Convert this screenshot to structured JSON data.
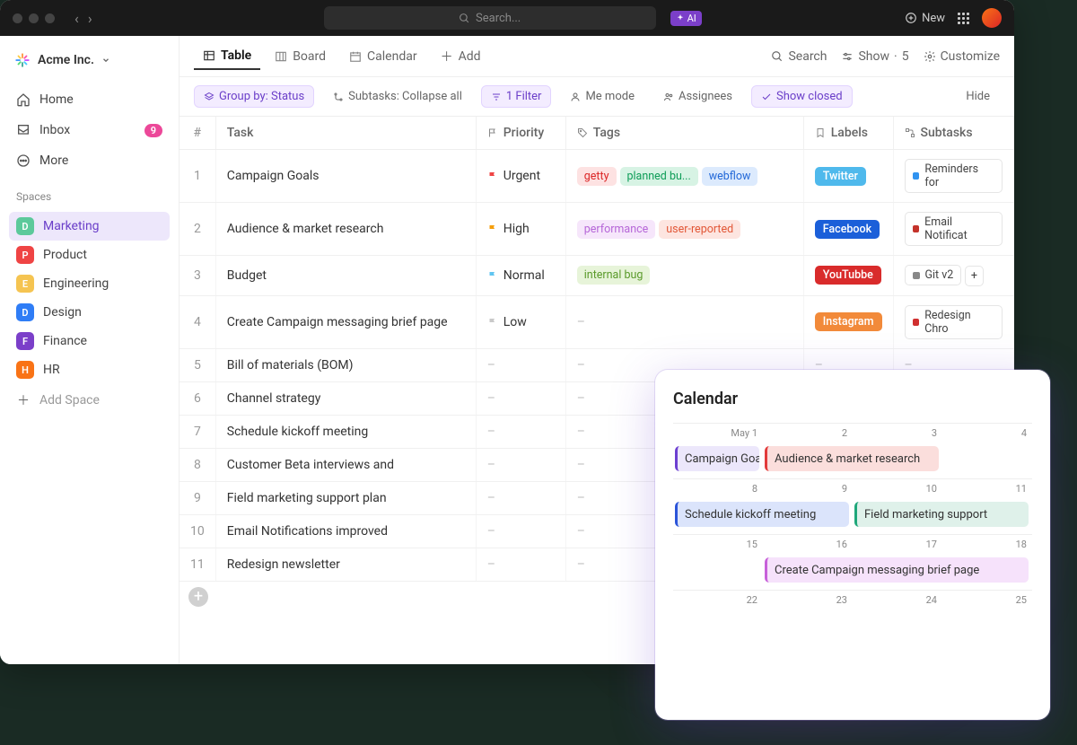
{
  "titlebar": {
    "search_placeholder": "Search...",
    "ai_label": "AI",
    "new_label": "New"
  },
  "workspace": {
    "name": "Acme Inc."
  },
  "nav": {
    "home": "Home",
    "inbox": "Inbox",
    "inbox_badge": "9",
    "more": "More"
  },
  "spaces_label": "Spaces",
  "spaces": [
    {
      "letter": "D",
      "name": "Marketing",
      "color": "#5cc99b",
      "active": true
    },
    {
      "letter": "P",
      "name": "Product",
      "color": "#ef4444"
    },
    {
      "letter": "E",
      "name": "Engineering",
      "color": "#f5c451"
    },
    {
      "letter": "D",
      "name": "Design",
      "color": "#2f7df6"
    },
    {
      "letter": "F",
      "name": "Finance",
      "color": "#7b3fc9"
    },
    {
      "letter": "H",
      "name": "HR",
      "color": "#f97316"
    }
  ],
  "add_space": "Add Space",
  "tabs": {
    "table": "Table",
    "board": "Board",
    "calendar": "Calendar",
    "add": "Add"
  },
  "toolbar_right": {
    "search": "Search",
    "show": "Show",
    "show_count": "5",
    "customize": "Customize"
  },
  "filters": {
    "group_by": "Group by: Status",
    "subtasks": "Subtasks: Collapse all",
    "filter": "1 Filter",
    "me_mode": "Me mode",
    "assignees": "Assignees",
    "show_closed": "Show closed",
    "hide": "Hide"
  },
  "columns": {
    "num": "#",
    "task": "Task",
    "priority": "Priority",
    "tags": "Tags",
    "labels": "Labels",
    "subtasks": "Subtasks"
  },
  "rows": [
    {
      "n": "1",
      "task": "Campaign Goals",
      "prio": "Urgent",
      "prio_color": "#ef4444",
      "tags": [
        {
          "t": "getty",
          "bg": "#fde2e2",
          "fg": "#dc2626"
        },
        {
          "t": "planned bu...",
          "bg": "#d7f3e4",
          "fg": "#0f9d58"
        },
        {
          "t": "webflow",
          "bg": "#dceafd",
          "fg": "#2268d8"
        }
      ],
      "label": {
        "t": "Twitter",
        "bg": "#4fb9ec"
      },
      "subtask": {
        "t": "Reminders for",
        "c": "#3093f0"
      }
    },
    {
      "n": "2",
      "task": "Audience & market research",
      "prio": "High",
      "prio_color": "#f59e0b",
      "tags": [
        {
          "t": "performance",
          "bg": "#f6e6fb",
          "fg": "#b667d8"
        },
        {
          "t": "user-reported",
          "bg": "#fde5e0",
          "fg": "#e25838"
        }
      ],
      "label": {
        "t": "Facebook",
        "bg": "#1b5fd9"
      },
      "subtask": {
        "t": "Email Notificat",
        "c": "#c4332b"
      }
    },
    {
      "n": "3",
      "task": "Budget",
      "prio": "Normal",
      "prio_color": "#60c5f1",
      "tags": [
        {
          "t": "internal bug",
          "bg": "#e7f4d9",
          "fg": "#5a9a2a"
        }
      ],
      "label": {
        "t": "YouTubbe",
        "bg": "#d92b2b"
      },
      "subtask": {
        "t": "Git v2",
        "c": "#888",
        "extra": "+"
      }
    },
    {
      "n": "4",
      "task": "Create Campaign messaging brief page",
      "prio": "Low",
      "prio_color": "#c9c9c9",
      "tags": [],
      "label": {
        "t": "Instagram",
        "bg": "#f28a3a"
      },
      "subtask": {
        "t": "Redesign Chro",
        "c": "#d02f2f"
      }
    },
    {
      "n": "5",
      "task": "Bill of materials (BOM)"
    },
    {
      "n": "6",
      "task": "Channel strategy"
    },
    {
      "n": "7",
      "task": "Schedule kickoff meeting"
    },
    {
      "n": "8",
      "task": "Customer Beta interviews and"
    },
    {
      "n": "9",
      "task": "Field marketing support plan"
    },
    {
      "n": "10",
      "task": "Email Notifications improved"
    },
    {
      "n": "11",
      "task": "Redesign newsletter"
    }
  ],
  "calendar": {
    "title": "Calendar",
    "dates": [
      "May 1",
      "2",
      "3",
      "4",
      "8",
      "9",
      "10",
      "11",
      "15",
      "16",
      "17",
      "18",
      "22",
      "23",
      "24",
      "25"
    ],
    "events": [
      {
        "row": 0,
        "col_start": 0,
        "col_span": 1,
        "text": "Campaign Goals",
        "bg": "#ece7fb",
        "bar": "#6c3fd1"
      },
      {
        "row": 0,
        "col_start": 1,
        "col_span": 2,
        "text": "Audience & market research",
        "bg": "#fbdedc",
        "bar": "#e23b3b"
      },
      {
        "row": 1,
        "col_start": 0,
        "col_span": 2,
        "text": "Schedule kickoff meeting",
        "bg": "#dbe4fb",
        "bar": "#2b54d9"
      },
      {
        "row": 1,
        "col_start": 2,
        "col_span": 2,
        "text": "Field marketing support",
        "bg": "#dff1ea",
        "bar": "#1fa77a"
      },
      {
        "row": 2,
        "col_start": 1,
        "col_span": 3,
        "text": "Create Campaign messaging brief page",
        "bg": "#f6e2fb",
        "bar": "#c760d9"
      }
    ]
  }
}
